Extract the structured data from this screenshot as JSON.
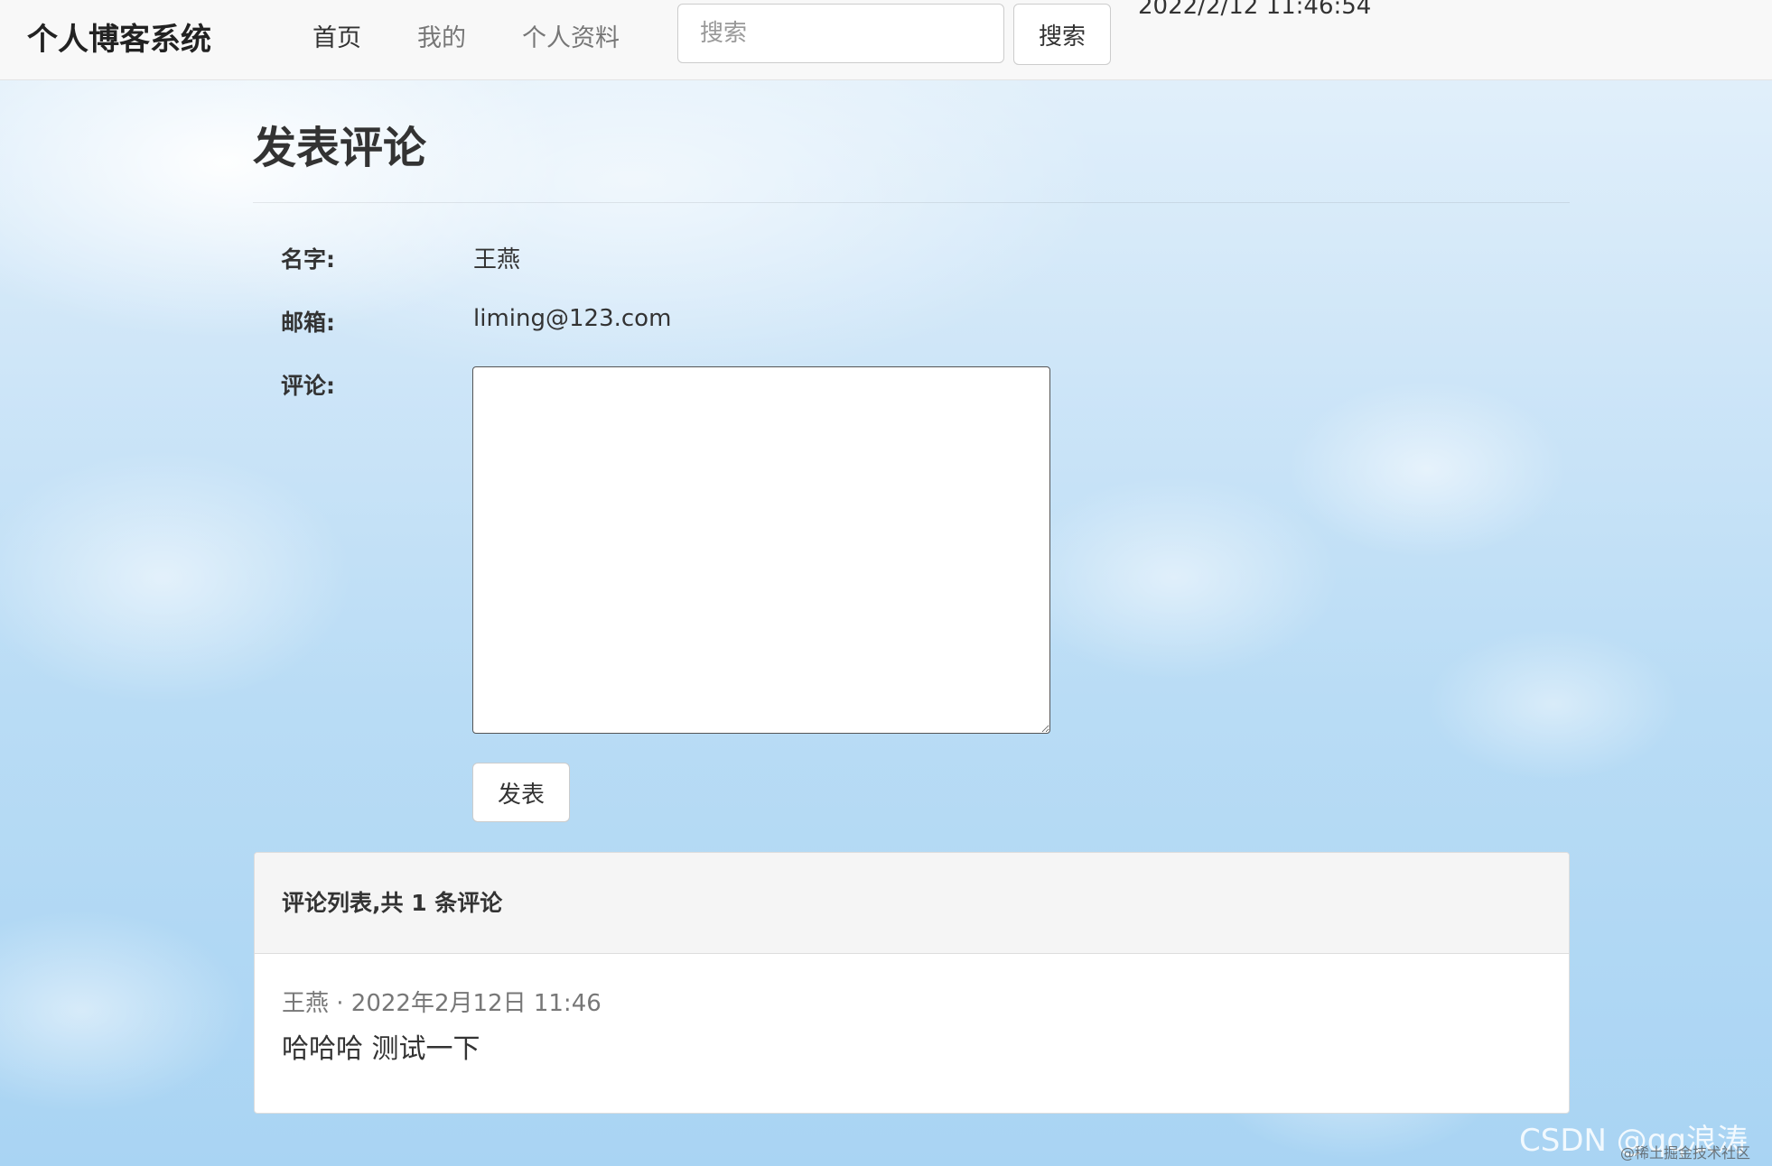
{
  "navbar": {
    "brand": "个人博客系统",
    "links": [
      "首页",
      "我的",
      "个人资料"
    ],
    "search_placeholder": "搜索",
    "search_button": "搜索",
    "datetime": "2022/2/12 11:46:54"
  },
  "form": {
    "title": "发表评论",
    "name_label": "名字:",
    "name_value": "王燕",
    "email_label": "邮箱:",
    "email_value": "liming@123.com",
    "comment_label": "评论:",
    "comment_value": "",
    "submit_label": "发表"
  },
  "comments": {
    "heading": "评论列表,共 1 条评论",
    "items": [
      {
        "meta": "王燕 · 2022年2月12日 11:46",
        "text": "哈哈哈 测试一下"
      }
    ]
  },
  "watermark": {
    "main": "CSDN @qq浪涛",
    "small": "@稀土掘金技术社区"
  }
}
